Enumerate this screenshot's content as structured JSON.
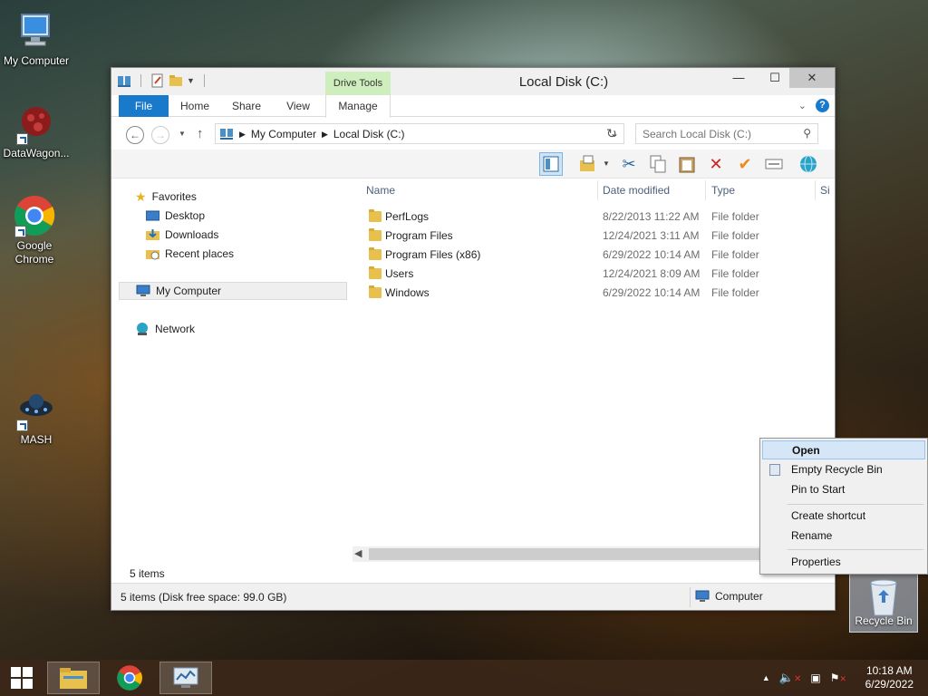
{
  "desktop": {
    "icons": [
      {
        "label": "My Computer"
      },
      {
        "label": "DataWagon..."
      },
      {
        "label": "Google Chrome"
      },
      {
        "label": "MASH"
      }
    ],
    "recycle_bin": {
      "label": "Recycle Bin"
    }
  },
  "window": {
    "title": "Local Disk (C:)",
    "contextual_group": "Drive Tools",
    "tabs": [
      "File",
      "Home",
      "Share",
      "View",
      "Manage"
    ],
    "minimize": "—",
    "maximize": "☐",
    "close": "✕",
    "help": "?"
  },
  "address": {
    "crumbs": [
      "My Computer",
      "Local Disk (C:)"
    ],
    "search_placeholder": "Search Local Disk (C:)"
  },
  "nav": {
    "favorites": "Favorites",
    "favorites_items": [
      "Desktop",
      "Downloads",
      "Recent places"
    ],
    "my_computer": "My Computer",
    "network": "Network"
  },
  "columns": {
    "name": "Name",
    "date": "Date modified",
    "type": "Type",
    "size": "Si"
  },
  "files": [
    {
      "name": "PerfLogs",
      "date": "8/22/2013 11:22 AM",
      "type": "File folder"
    },
    {
      "name": "Program Files",
      "date": "12/24/2021 3:11 AM",
      "type": "File folder"
    },
    {
      "name": "Program Files (x86)",
      "date": "6/29/2022 10:14 AM",
      "type": "File folder"
    },
    {
      "name": "Users",
      "date": "12/24/2021 8:09 AM",
      "type": "File folder"
    },
    {
      "name": "Windows",
      "date": "6/29/2022 10:14 AM",
      "type": "File folder"
    }
  ],
  "status": {
    "item_count": "5 items",
    "bar_left": "5 items (Disk free space: 99.0 GB)",
    "bar_right": "Computer"
  },
  "context_menu": {
    "items": [
      "Open",
      "Empty Recycle Bin",
      "Pin to Start",
      "Create shortcut",
      "Rename",
      "Properties"
    ]
  },
  "taskbar": {
    "time": "10:18 AM",
    "date": "6/29/2022"
  },
  "colors": {
    "accent": "#1979ca",
    "drive_tools": "#cfeebd",
    "highlight": "#d5e6f7"
  }
}
